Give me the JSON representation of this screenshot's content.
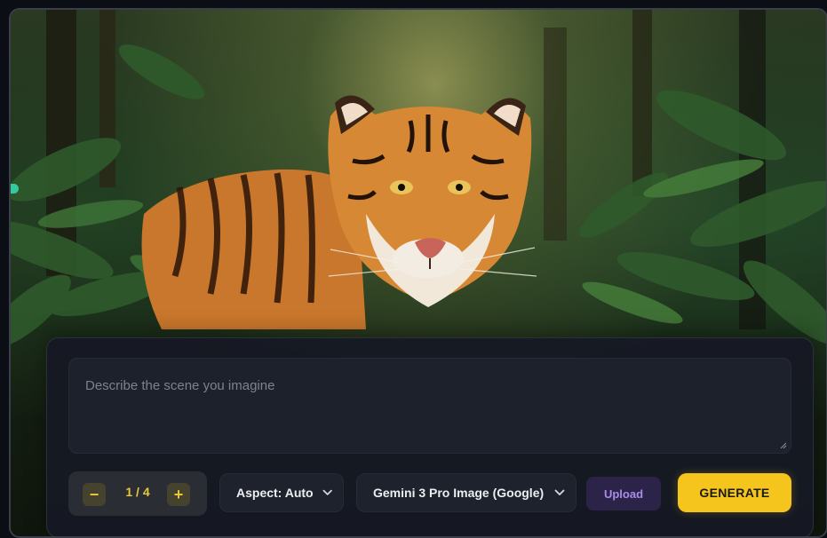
{
  "hero": {
    "image_alt": "Tiger in jungle"
  },
  "prompt": {
    "placeholder": "Describe the scene you imagine",
    "value": ""
  },
  "stepper": {
    "minus": "−",
    "plus": "+",
    "count": "1 / 4"
  },
  "aspect": {
    "label": "Aspect: Auto"
  },
  "model": {
    "label": "Gemini 3 Pro Image (Google)"
  },
  "upload": {
    "label": "Upload"
  },
  "generate": {
    "label": "GENERATE"
  },
  "colors": {
    "accent": "#f5c51e",
    "upload_text": "#a98ce8",
    "indicator": "#35c9a0"
  },
  "icons": {
    "dropdown": "chevron-down-icon",
    "resize": "resize-grip-icon"
  }
}
